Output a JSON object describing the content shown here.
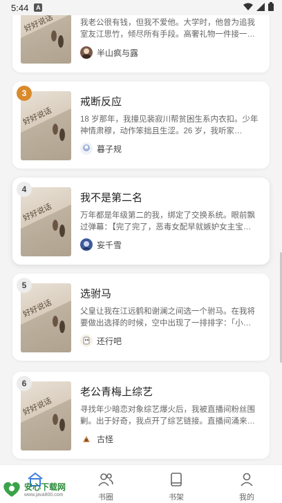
{
  "status_bar": {
    "time": "5:44",
    "notification_badge": "A"
  },
  "books": [
    {
      "rank": "",
      "title": "",
      "description": "我老公很有钱，但我不爱他。大学时，他曾为追我室友江思竹，倾尽所有手段。高奢礼物一件接一…",
      "author": "半山疯与露"
    },
    {
      "rank": "3",
      "title": "戒断反应",
      "description": "18 岁那年，我撞见裴寂川帮贫困生系内衣扣。少年神情肃穆，动作笨拙且生涩。26 岁，我听家…",
      "author": "暮子规"
    },
    {
      "rank": "4",
      "title": "我不是第二名",
      "description": "万年都是年级第二的我，绑定了交换系统。眼前飘过弹幕：【完了完了，恶毒女配早就嫉妒女主宝…",
      "author": "妄千雪"
    },
    {
      "rank": "5",
      "title": "选驸马",
      "description": "父皇让我在江远鹤和谢澜之间选一个驸马。在我将要做出选择的时候，空中出现了一排排字：「小…",
      "author": "还行吧"
    },
    {
      "rank": "6",
      "title": "老公青梅上综艺",
      "description": "寻找年少暗恋对象综艺爆火后，我被直播间粉丝围剿。出于好奇，我点开了综艺链接。直播间涌来…",
      "author": "古怪"
    }
  ],
  "cover_text": "好好说话",
  "tabbar": {
    "items": [
      {
        "label": "首页"
      },
      {
        "label": "书圈"
      },
      {
        "label": "书架"
      },
      {
        "label": "我的"
      }
    ]
  },
  "watermark": {
    "main": "安心下载网",
    "sub": "www.java800.com"
  },
  "colors": {
    "accent": "#3b7bd9",
    "rank_gold": "#d98a2b"
  }
}
